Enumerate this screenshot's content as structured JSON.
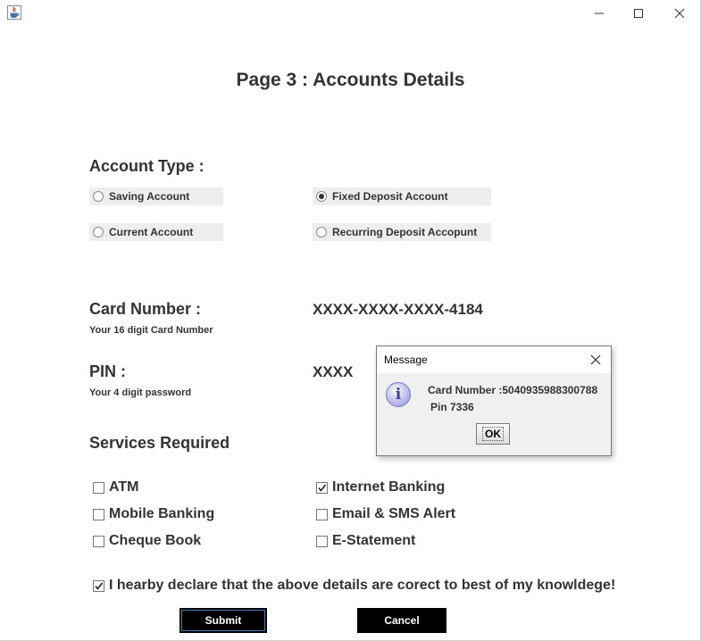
{
  "window": {
    "icons": {
      "app": "java-coffee-icon",
      "minimize": "minimize-icon",
      "maximize": "maximize-icon",
      "close": "close-icon"
    }
  },
  "page": {
    "title": "Page 3 : Accounts Details"
  },
  "account_type": {
    "heading": "Account Type :",
    "options": [
      {
        "label": "Saving Account",
        "selected": false
      },
      {
        "label": "Fixed Deposit Account",
        "selected": true
      },
      {
        "label": "Current Account",
        "selected": false
      },
      {
        "label": "Recurring Deposit Accopunt",
        "selected": false
      }
    ]
  },
  "card": {
    "heading": "Card Number :",
    "hint": "Your 16 digit Card Number",
    "value": "XXXX-XXXX-XXXX-4184"
  },
  "pin": {
    "heading": "PIN :",
    "hint": "Your 4 digit password",
    "value": "XXXX"
  },
  "services": {
    "heading": "Services Required",
    "items": [
      {
        "label": "ATM",
        "checked": false
      },
      {
        "label": "Internet Banking",
        "checked": true
      },
      {
        "label": "Mobile Banking",
        "checked": false
      },
      {
        "label": "Email & SMS Alert",
        "checked": false
      },
      {
        "label": "Cheque Book",
        "checked": false
      },
      {
        "label": "E-Statement",
        "checked": false
      }
    ]
  },
  "declaration": {
    "label": "I hearby declare that the above details are corect to best of my knowldege!",
    "checked": true
  },
  "buttons": {
    "submit": "Submit",
    "cancel": "Cancel"
  },
  "dialog": {
    "title": "Message",
    "line1": "Card Number :5040935988300788",
    "line2": "Pin 7336",
    "ok": "OK",
    "icon": "info-icon"
  },
  "colors": {
    "button_bg": "#000000",
    "button_fg": "#ffffff",
    "radio_bg": "#eeeeee",
    "text": "#333333"
  }
}
